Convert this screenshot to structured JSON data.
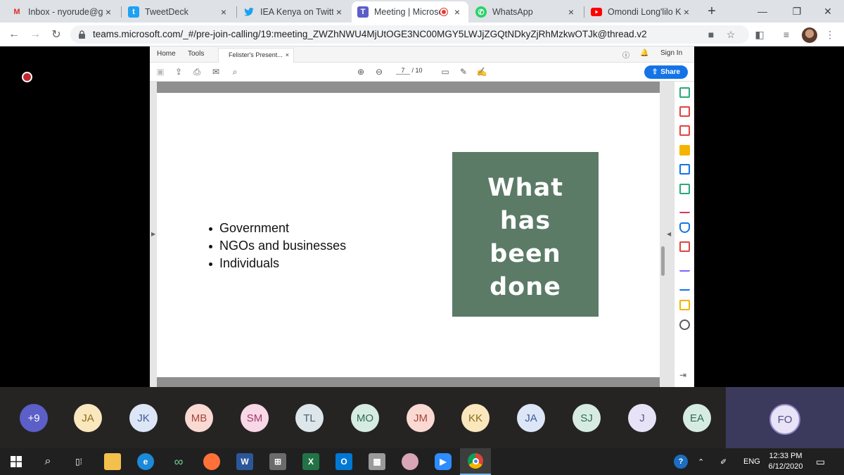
{
  "browser": {
    "tabs": [
      {
        "title": "Inbox - nyorude@gm",
        "icon": "gmail-icon",
        "color": "#d93025"
      },
      {
        "title": "TweetDeck",
        "icon": "tweetdeck-icon",
        "color": "#1da1f2"
      },
      {
        "title": "IEA Kenya on Twitter",
        "icon": "twitter-icon",
        "color": "#1da1f2"
      },
      {
        "title": "Meeting | Microso",
        "icon": "teams-icon",
        "color": "#5b5fc7",
        "active": true,
        "recording": true
      },
      {
        "title": "WhatsApp",
        "icon": "whatsapp-icon",
        "color": "#25d366"
      },
      {
        "title": "Omondi Long'lilo Ko",
        "icon": "youtube-icon",
        "color": "#ff0000"
      }
    ],
    "new_tab": "+",
    "url": "teams.microsoft.com/_#/pre-join-calling/19:meeting_ZWZhNWU4MjUtOGE3NC00MGY5LWJjZGQtNDkyZjRhMzkwOTJk@thread.v2"
  },
  "pdf": {
    "menu_home": "Home",
    "menu_tools": "Tools",
    "doc_tab": "Felister's Present...",
    "doc_tab_close": "×",
    "sign_in": "Sign In",
    "page_current": "7",
    "page_total": "/ 10",
    "share": "Share",
    "bullets": [
      "Government",
      "NGOs and businesses",
      "Individuals"
    ],
    "box_line1": "What",
    "box_line2": "has",
    "box_line3": "been",
    "box_line4": "done",
    "box_color": "#5b7b67"
  },
  "participants": {
    "more": "+9",
    "list": [
      {
        "initials": "JA",
        "color": "#fbe7bd"
      },
      {
        "initials": "JK",
        "color": "#dde6f7"
      },
      {
        "initials": "MB",
        "color": "#fbd9d3"
      },
      {
        "initials": "SM",
        "color": "#f8d7e6"
      },
      {
        "initials": "TL",
        "color": "#dde6ea"
      },
      {
        "initials": "MO",
        "color": "#d6ece2"
      },
      {
        "initials": "JM",
        "color": "#fbd9d3"
      },
      {
        "initials": "KK",
        "color": "#fbe7bd"
      },
      {
        "initials": "JA",
        "color": "#dde6f7"
      },
      {
        "initials": "SJ",
        "color": "#d6ece2"
      },
      {
        "initials": "J",
        "color": "#e6e3f6"
      },
      {
        "initials": "EA",
        "color": "#d6ece2"
      }
    ],
    "self": "FO"
  },
  "taskbar": {
    "lang": "ENG",
    "time": "12:33 PM",
    "date": "6/12/2020"
  }
}
